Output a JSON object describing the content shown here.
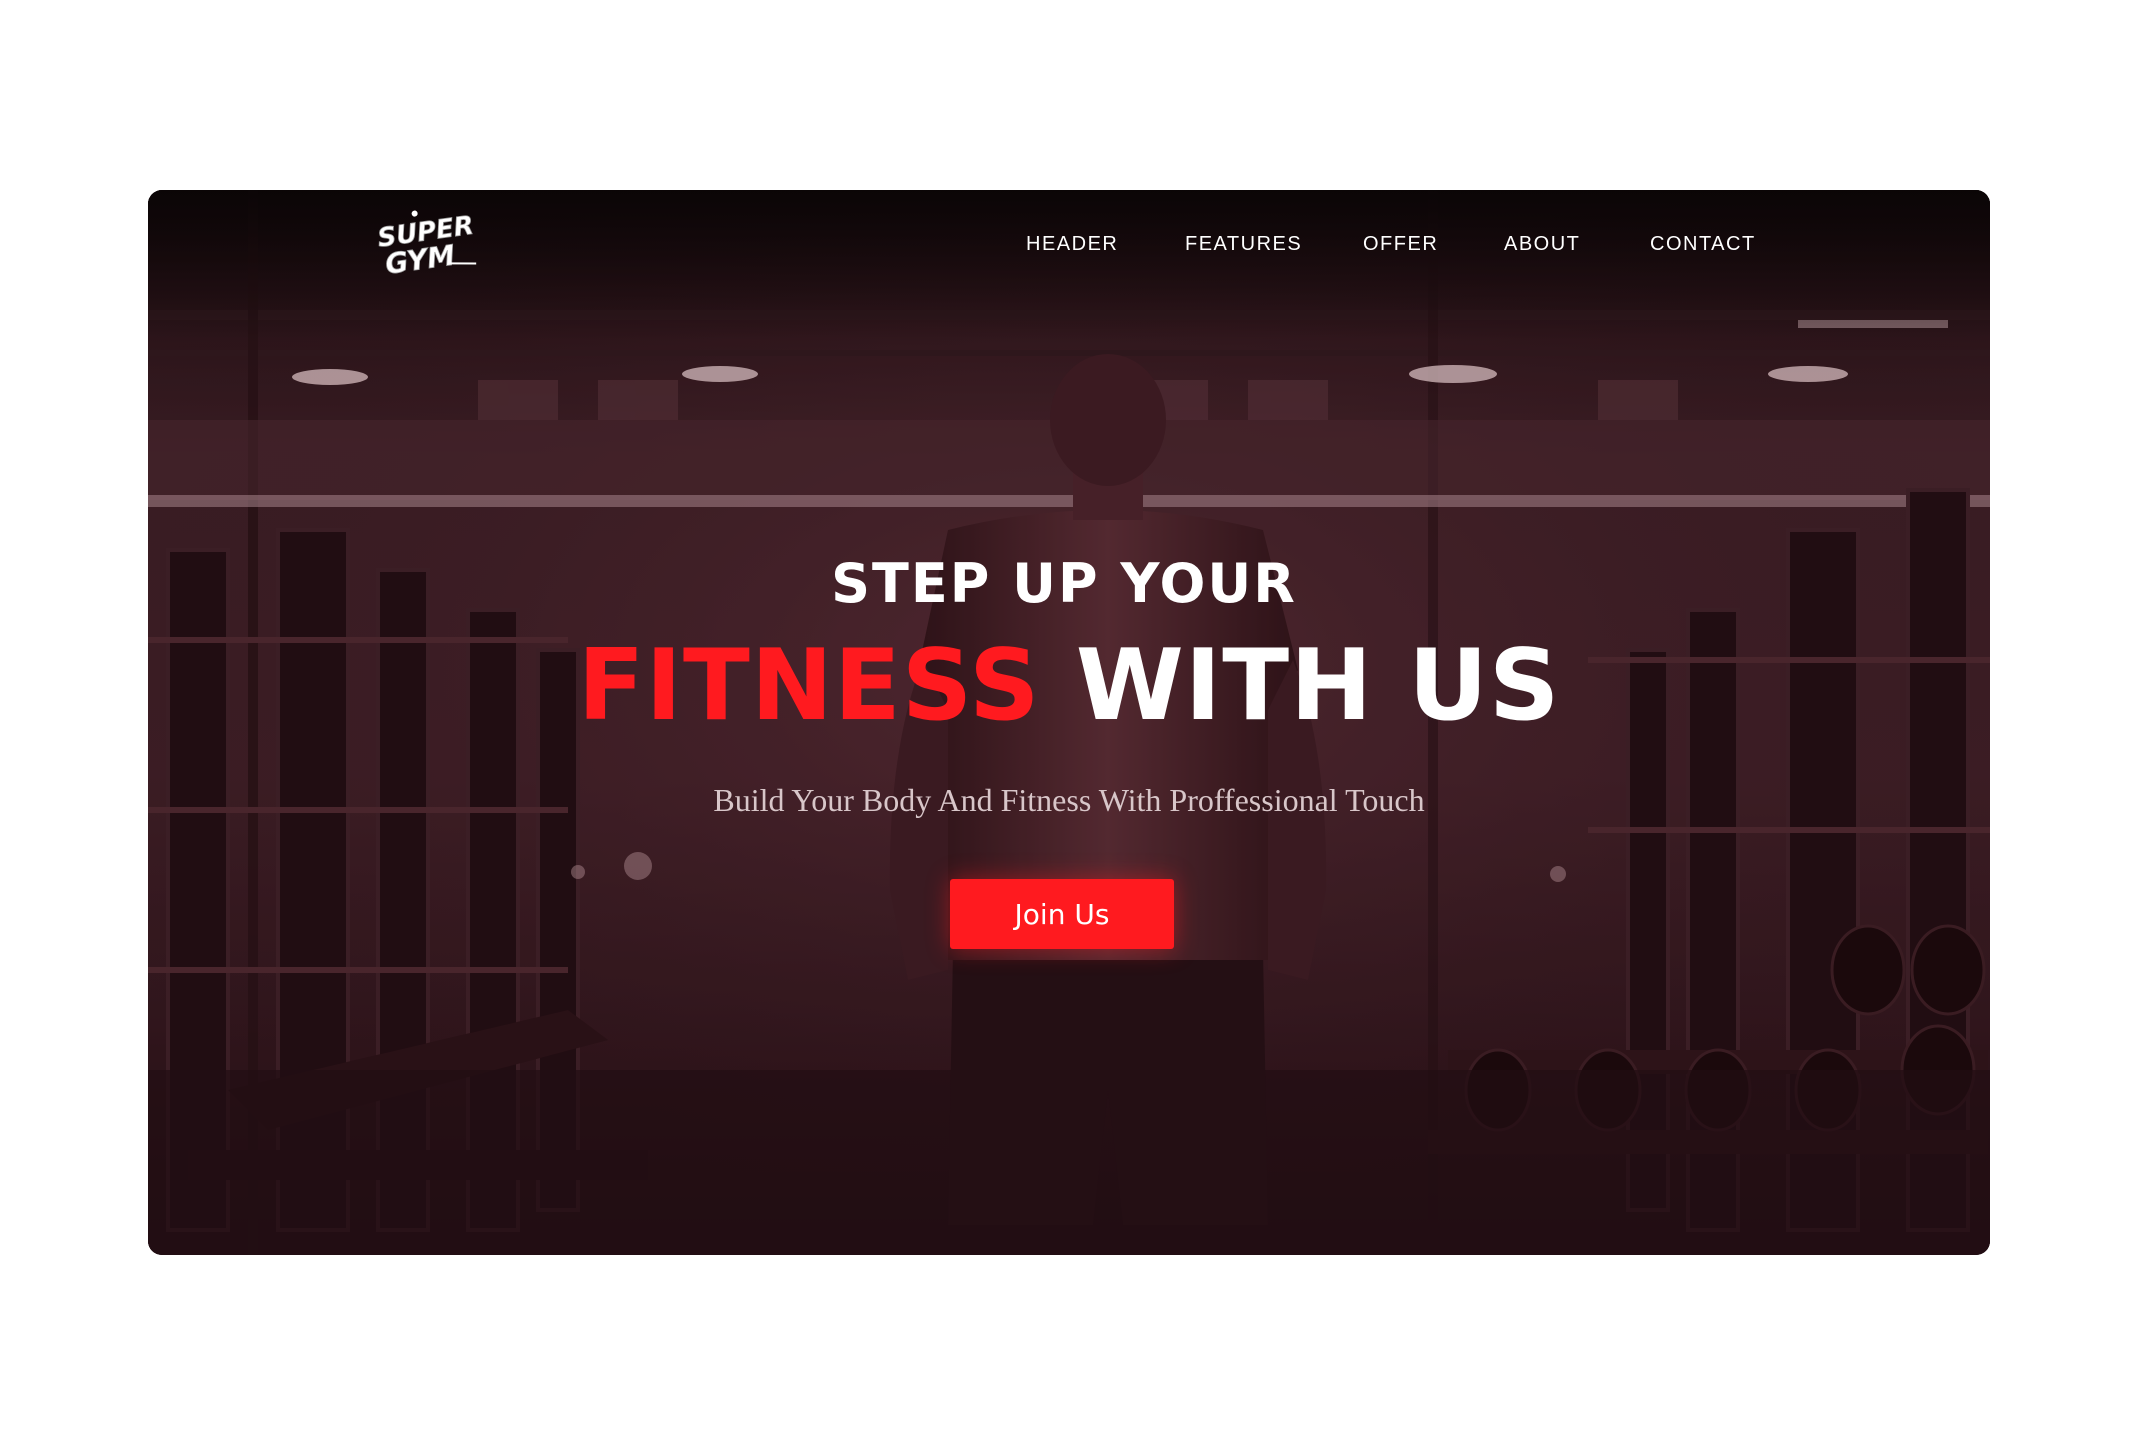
{
  "brand": {
    "logo_line1": "SUPER",
    "logo_line2": "GYM"
  },
  "nav": {
    "items": [
      {
        "label": "HEADER"
      },
      {
        "label": "FEATURES"
      },
      {
        "label": "OFFER"
      },
      {
        "label": "ABOUT"
      },
      {
        "label": "CONTACT"
      }
    ]
  },
  "hero": {
    "line1": "STEP UP YOUR",
    "line2_accent": "FITNESS",
    "line2_rest": "WITH US",
    "subtitle": "Build Your Body And Fitness With Proffessional Touch",
    "cta_label": "Join Us",
    "background_icon": "gym-athlete-photo"
  },
  "colors": {
    "accent": "#ff1a1f",
    "text": "#ffffff",
    "subtitle": "#d8c6c9",
    "overlay": "#2a1218"
  }
}
